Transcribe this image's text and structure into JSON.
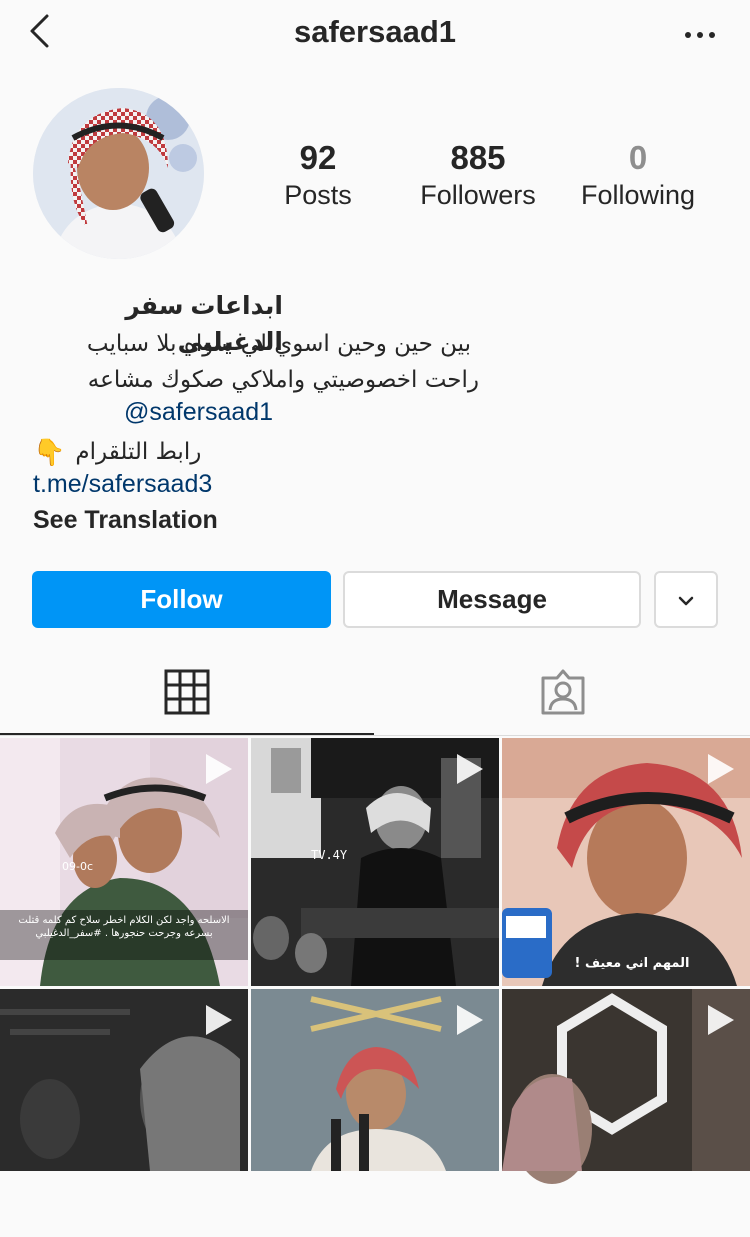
{
  "header": {
    "username": "safersaad1"
  },
  "stats": {
    "posts": {
      "value": "92",
      "label": "Posts"
    },
    "followers": {
      "value": "885",
      "label": "Followers"
    },
    "following": {
      "value": "0",
      "label": "Following"
    }
  },
  "bio": {
    "name": "ابداعات سفر الدغيلبي",
    "line1": "بين حين وحين اسوي لي سواه بلا سبايب",
    "line2": "راحت اخصوصيتي واملاكي صكوك مشاعه",
    "mention": "@safersaad1",
    "telegram_label": "رابط التلقرام",
    "telegram_emoji": "👇",
    "link": "t.me/safersaad3",
    "see_translation": "See Translation"
  },
  "actions": {
    "follow": "Follow",
    "message": "Message"
  },
  "tabs": [
    "grid",
    "tagged"
  ],
  "posts": [
    {
      "caption": "الاسلحه واجد لكن الكلام اخطر سلاح كم كلمه قتلت بسرعه وجرحت حنجورها . #سفر_الدغيلبي",
      "badge": "09-0c",
      "type": "video"
    },
    {
      "caption": "",
      "badge": "TV.4Y",
      "type": "video"
    },
    {
      "caption": "المهم اني معيف !",
      "badge": "",
      "type": "video"
    },
    {
      "caption": "",
      "badge": "",
      "type": "video"
    },
    {
      "caption": "",
      "badge": "",
      "type": "video"
    },
    {
      "caption": "",
      "badge": "",
      "type": "video"
    }
  ],
  "colors": {
    "primary": "#0095f6",
    "link": "#00376b",
    "text": "#262626",
    "muted": "#8e8e8e",
    "border": "#dbdbdb"
  }
}
